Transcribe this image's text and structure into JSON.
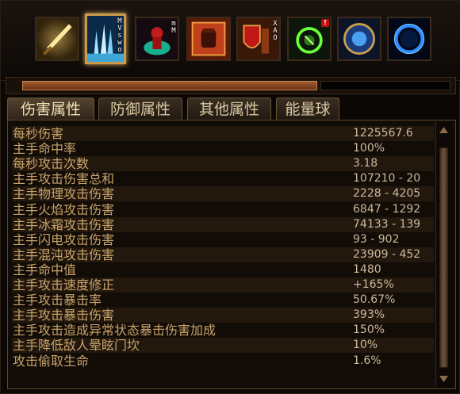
{
  "skillbar": {
    "skills": [
      {
        "name": "sword-skill-icon",
        "hotkey": "",
        "badge": ""
      },
      {
        "name": "ice-spikes-skill-icon",
        "hotkey": "MVswo",
        "badge": ""
      },
      {
        "name": "blood-ritual-skill-icon",
        "hotkey": "mM",
        "badge": ""
      },
      {
        "name": "fist-skill-icon",
        "hotkey": "",
        "badge": ""
      },
      {
        "name": "shield-warrior-skill-icon",
        "hotkey": "XAO",
        "badge": ""
      },
      {
        "name": "poison-ring-skill-icon",
        "hotkey": "",
        "badge": "!"
      },
      {
        "name": "arcane-orb-skill-icon",
        "hotkey": "",
        "badge": ""
      },
      {
        "name": "portal-skill-icon",
        "hotkey": "",
        "badge": ""
      }
    ],
    "selected_index": 1
  },
  "progress": {
    "fraction": 0.7
  },
  "tabs": [
    "伤害属性",
    "防御属性",
    "其他属性",
    "能量球"
  ],
  "active_tab": 0,
  "stats": [
    {
      "label": "每秒伤害",
      "value": "1225567.6"
    },
    {
      "label": "主手命中率",
      "value": "100%"
    },
    {
      "label": "每秒攻击次数",
      "value": "3.18"
    },
    {
      "label": "主手攻击伤害总和",
      "value": "107210 - 20"
    },
    {
      "label": "主手物理攻击伤害",
      "value": "2228 - 4205"
    },
    {
      "label": "主手火焰攻击伤害",
      "value": "6847 - 1292"
    },
    {
      "label": "主手冰霜攻击伤害",
      "value": "74133 - 139"
    },
    {
      "label": "主手闪电攻击伤害",
      "value": "93 - 902"
    },
    {
      "label": "主手混沌攻击伤害",
      "value": "23909 - 452"
    },
    {
      "label": "主手命中值",
      "value": "1480"
    },
    {
      "label": "主手攻击速度修正",
      "value": "+165%"
    },
    {
      "label": "主手攻击暴击率",
      "value": "50.67%"
    },
    {
      "label": "主手攻击暴击伤害",
      "value": "393%"
    },
    {
      "label": "主手攻击造成异常状态暴击伤害加成",
      "value": "150%"
    },
    {
      "label": "主手降低敌人晕眩门坎",
      "value": "10%"
    },
    {
      "label": "攻击偷取生命",
      "value": "1.6%"
    }
  ],
  "colors": {
    "label": "#c9a36a",
    "value": "#cdb89a",
    "accent": "#c99a4a"
  }
}
